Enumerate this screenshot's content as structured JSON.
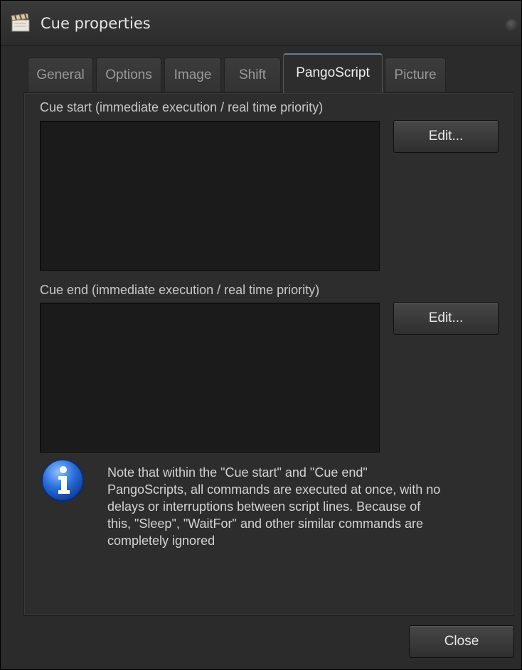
{
  "window": {
    "title": "Cue properties",
    "icon": "clapperboard-icon"
  },
  "tabs": [
    {
      "label": "General",
      "active": false
    },
    {
      "label": "Options",
      "active": false
    },
    {
      "label": "Image",
      "active": false
    },
    {
      "label": "Shift",
      "active": false
    },
    {
      "label": "PangoScript",
      "active": true
    },
    {
      "label": "Picture",
      "active": false
    }
  ],
  "cue_start": {
    "label": "Cue start (immediate execution / real time priority)",
    "script": "",
    "edit_button": "Edit..."
  },
  "cue_end": {
    "label": "Cue end (immediate execution / real time priority)",
    "script": "",
    "edit_button": "Edit..."
  },
  "note": {
    "icon": "info-icon",
    "lines": [
      "Note that within the \"Cue start\" and \"Cue end\"",
      "PangoScripts, all commands are executed at once, with no",
      "delays or interruptions between script lines. Because of",
      "this, \"Sleep\", \"WaitFor\" and other similar commands are",
      "completely ignored"
    ]
  },
  "footer": {
    "close_button": "Close"
  },
  "colors": {
    "background": "#2b2b2b",
    "script_box": "#1b1b1b",
    "info_blue": "#1e5fc8"
  }
}
